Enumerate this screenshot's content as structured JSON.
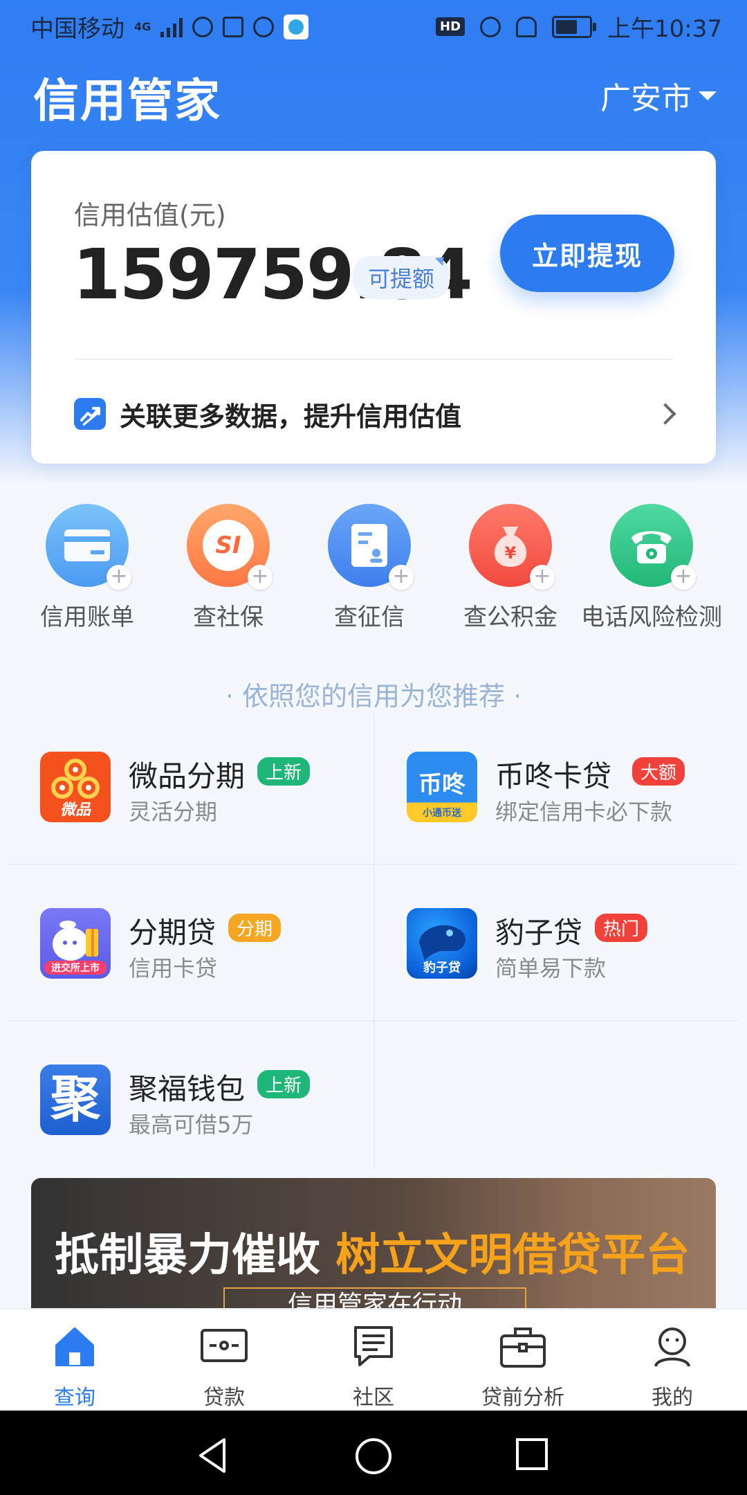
{
  "status_bar": {
    "carrier": "中国移动",
    "network": "4G",
    "time": "上午10:37",
    "hd": "HD"
  },
  "header": {
    "app_title": "信用管家",
    "city": "广安市"
  },
  "credit_card": {
    "label": "信用估值(元)",
    "amount": "159759.84",
    "tag": "可提额",
    "cta": "立即提现",
    "link_text": "关联更多数据，提升信用估值"
  },
  "tools": [
    {
      "label": "信用账单",
      "icon": "credit-card-icon",
      "color": "#5aa9f5"
    },
    {
      "label": "查社保",
      "icon": "social-security-icon",
      "color": "#ff8a4a"
    },
    {
      "label": "查征信",
      "icon": "credit-report-icon",
      "color": "#4a8ef2"
    },
    {
      "label": "查公积金",
      "icon": "money-bag-icon",
      "color": "#f5574f"
    },
    {
      "label": "电话风险检测",
      "icon": "telephone-icon",
      "color": "#2fc78a"
    }
  ],
  "section_title": "· 依照您的信用为您推荐 ·",
  "products": [
    {
      "name": "微品分期",
      "badge": "上新",
      "badge_color": "#1fb67a",
      "desc": "灵活分期",
      "logo": "weipin-logo"
    },
    {
      "name": "币咚卡贷",
      "badge": "大额",
      "badge_color": "#f0413a",
      "desc": "绑定信用卡必下款",
      "logo": "bidong-logo"
    },
    {
      "name": "分期贷",
      "badge": "分期",
      "badge_color": "#f5a623",
      "desc": "信用卡贷",
      "logo": "fenqidai-logo"
    },
    {
      "name": "豹子贷",
      "badge": "热门",
      "badge_color": "#f0413a",
      "desc": "简单易下款",
      "logo": "baozidai-logo"
    },
    {
      "name": "聚福钱包",
      "badge": "上新",
      "badge_color": "#1fb67a",
      "desc": "最高可借5万",
      "logo": "jufu-logo"
    }
  ],
  "banner": {
    "text_white": "抵制暴力催收 ",
    "text_orange": "树立文明借贷平台",
    "subtitle": "信用管家在行动"
  },
  "bottom_nav": [
    {
      "label": "查询",
      "icon": "home-icon",
      "active": true
    },
    {
      "label": "贷款",
      "icon": "loan-card-icon",
      "active": false
    },
    {
      "label": "社区",
      "icon": "community-icon",
      "active": false
    },
    {
      "label": "贷前分析",
      "icon": "briefcase-icon",
      "active": false
    },
    {
      "label": "我的",
      "icon": "profile-icon",
      "active": false
    }
  ],
  "logo_text": {
    "weipin": "微品",
    "bidong": "币咚",
    "bidong_sub": "小通币送",
    "fenqidai_sub": "进交所上市",
    "baozidai": "豹子贷",
    "jufu": "聚",
    "social_security": "SI"
  },
  "colors": {
    "primary": "#2c7bf0",
    "hero_top": "#2f7df2"
  }
}
